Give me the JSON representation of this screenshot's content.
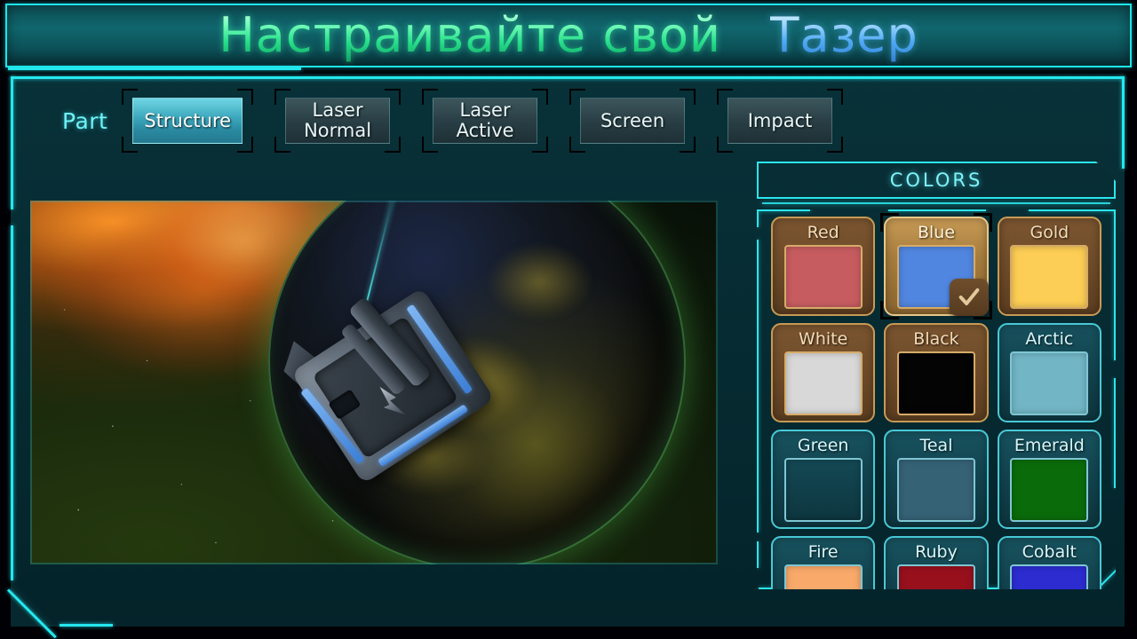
{
  "title": {
    "full": "Настраивайте свой Тазер",
    "segment_green": "Настраивайте свой",
    "segment_blue": "Тазер"
  },
  "part_selector": {
    "label": "Part",
    "tabs": [
      {
        "label": "Structure",
        "selected": true
      },
      {
        "label": "Laser\nNormal",
        "selected": false
      },
      {
        "label": "Laser\nActive",
        "selected": false
      },
      {
        "label": "Screen",
        "selected": false
      },
      {
        "label": "Impact",
        "selected": false
      }
    ]
  },
  "preview": {
    "scene": "spaceship-over-planet",
    "vehicle_name": "tazer-vehicle"
  },
  "colors_panel": {
    "header": "COLORS",
    "selected_color": "Blue",
    "check_icon": "check-icon",
    "swatches": [
      {
        "name": "Red",
        "hex": "#c75c60",
        "style": "brown",
        "selected": false
      },
      {
        "name": "Blue",
        "hex": "#5186e0",
        "style": "brown",
        "selected": true
      },
      {
        "name": "Gold",
        "hex": "#fdce55",
        "style": "brown",
        "selected": false
      },
      {
        "name": "White",
        "hex": "#d8d8d8",
        "style": "brown",
        "selected": false
      },
      {
        "name": "Black",
        "hex": "#040404",
        "style": "brown",
        "selected": false
      },
      {
        "name": "Arctic",
        "hex": "#72b6c6",
        "style": "teal",
        "selected": false
      },
      {
        "name": "Green",
        "hex": "#4cc council",
        "style": "teal",
        "selected": false
      },
      {
        "name": "Teal",
        "hex": "#356275",
        "style": "teal",
        "selected": false
      },
      {
        "name": "Emerald",
        "hex": "#0a6b0a",
        "style": "teal",
        "selected": false
      },
      {
        "name": "Fire",
        "hex": "#f9a96a",
        "style": "teal",
        "selected": false
      },
      {
        "name": "Ruby",
        "hex": "#97101c",
        "style": "teal",
        "selected": false
      },
      {
        "name": "Cobalt",
        "hex": "#2c2cd0",
        "style": "teal",
        "selected": false
      }
    ]
  },
  "theme": {
    "accent_cyan": "#2ae6ec",
    "panel_bg": "#06282e",
    "title_bar_bg": "#10666d"
  }
}
